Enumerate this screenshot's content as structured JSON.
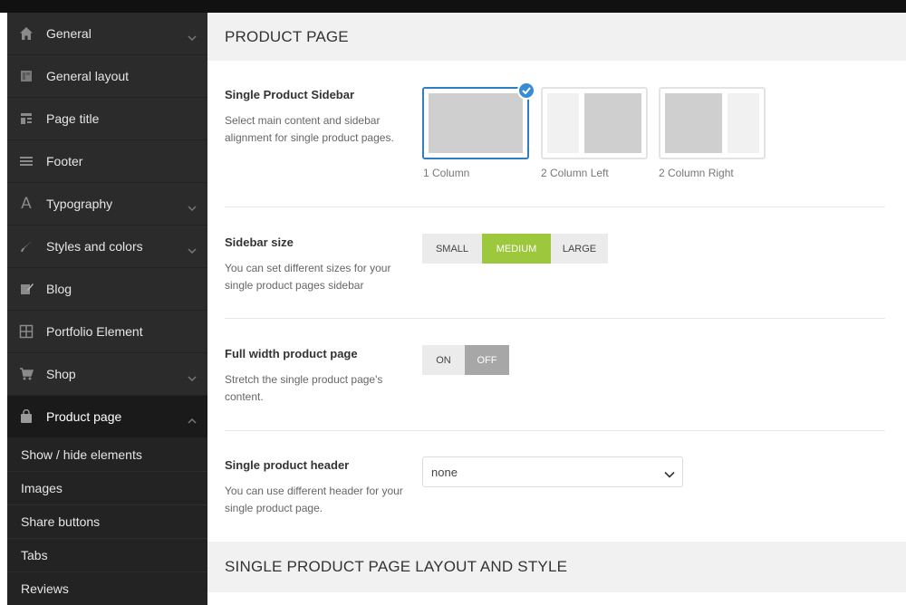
{
  "sidebar": {
    "items": [
      {
        "label": "General",
        "icon": "home-icon",
        "expandable": true
      },
      {
        "label": "General layout",
        "icon": "layout-icon",
        "expandable": false
      },
      {
        "label": "Page title",
        "icon": "page-title-icon",
        "expandable": false
      },
      {
        "label": "Footer",
        "icon": "footer-icon",
        "expandable": false
      },
      {
        "label": "Typography",
        "icon": "typography-icon",
        "expandable": true
      },
      {
        "label": "Styles and colors",
        "icon": "brush-icon",
        "expandable": true
      },
      {
        "label": "Blog",
        "icon": "edit-icon",
        "expandable": false
      },
      {
        "label": "Portfolio Element",
        "icon": "grid-icon",
        "expandable": false
      },
      {
        "label": "Shop",
        "icon": "cart-icon",
        "expandable": true
      },
      {
        "label": "Product page",
        "icon": "bag-icon",
        "expandable": true,
        "active": true
      }
    ],
    "subitems": [
      {
        "label": "Show / hide elements"
      },
      {
        "label": "Images"
      },
      {
        "label": "Share buttons"
      },
      {
        "label": "Tabs"
      },
      {
        "label": "Reviews"
      }
    ]
  },
  "main": {
    "section_title": "PRODUCT PAGE",
    "bottom_section_title": "SINGLE PRODUCT PAGE LAYOUT AND STYLE",
    "sidebar_option": {
      "title": "Single Product Sidebar",
      "desc": "Select main content and sidebar alignment for single product pages.",
      "layouts": [
        {
          "label": "1 Column",
          "selected": true
        },
        {
          "label": "2 Column Left",
          "selected": false
        },
        {
          "label": "2 Column Right",
          "selected": false
        }
      ]
    },
    "sidebar_size": {
      "title": "Sidebar size",
      "desc": "You can set different sizes for your single product pages sidebar",
      "options": [
        "SMALL",
        "MEDIUM",
        "LARGE"
      ],
      "selected": "MEDIUM"
    },
    "full_width": {
      "title": "Full width product page",
      "desc": "Stretch the single product page's content.",
      "on_label": "ON",
      "off_label": "OFF",
      "value": "OFF"
    },
    "header": {
      "title": "Single product header",
      "desc": "You can use different header for your single product page.",
      "value": "none"
    }
  },
  "colors": {
    "accent_green": "#9dc73c",
    "selected_blue": "#2f7ec0",
    "sidebar_bg": "#2b2b2b",
    "toggle_off": "#a7a7a7"
  }
}
